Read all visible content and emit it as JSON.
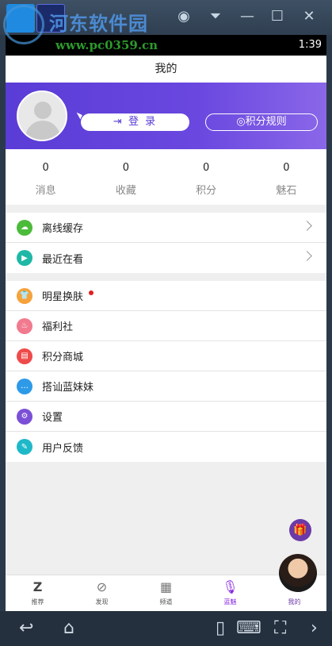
{
  "watermark": {
    "text": "河东软件园",
    "url": "www.pc0359.cn"
  },
  "emulator": {
    "icons": {
      "user": "user-circle-icon",
      "dropdown": "triangle-down-icon",
      "minimize": "minimize-icon",
      "maximize": "maximize-icon",
      "close": "close-icon"
    }
  },
  "status": {
    "time": "1:39"
  },
  "header": {
    "title": "我的"
  },
  "profile": {
    "login_label": "登 录",
    "points_rules_label": "积分规则",
    "accent": "#5a3cd6"
  },
  "stats": [
    {
      "value": "0",
      "label": "消息"
    },
    {
      "value": "0",
      "label": "收藏"
    },
    {
      "value": "0",
      "label": "积分"
    },
    {
      "value": "0",
      "label": "魅石"
    }
  ],
  "group1": [
    {
      "label": "离线缓存",
      "icon": "cloud-icon",
      "color": "#4cbb3a"
    },
    {
      "label": "最近在看",
      "icon": "play-icon",
      "color": "#1fb8a6"
    }
  ],
  "group2": [
    {
      "label": "明星换肤",
      "icon": "shirt-icon",
      "color": "#f6a23a",
      "badge": true
    },
    {
      "label": "福利社",
      "icon": "gift-bag-icon",
      "color": "#f27a8e"
    },
    {
      "label": "积分商城",
      "icon": "store-icon",
      "color": "#ef4a4a"
    },
    {
      "label": "搭讪蓝妹妹",
      "icon": "chat-icon",
      "color": "#2d9ae8"
    },
    {
      "label": "设置",
      "icon": "gear-icon",
      "color": "#7b4fd6"
    },
    {
      "label": "用户反馈",
      "icon": "edit-icon",
      "color": "#1fb8c9"
    }
  ],
  "tabbar": [
    {
      "label": "推荐",
      "icon": "z-logo-icon"
    },
    {
      "label": "发现",
      "icon": "compass-icon"
    },
    {
      "label": "频道",
      "icon": "grid-icon"
    },
    {
      "label": "蓝魅",
      "icon": "microphone-icon"
    },
    {
      "label": "我的",
      "icon": "avatar-icon"
    }
  ]
}
